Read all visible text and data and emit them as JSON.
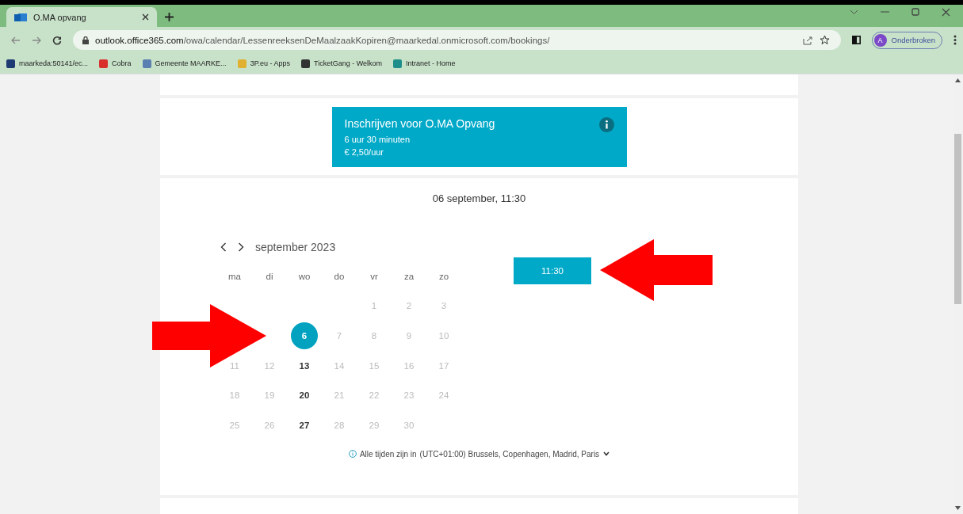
{
  "browser": {
    "tab_title": "O.MA opvang",
    "url_host": "outlook.office365.com",
    "url_path": "/owa/calendar/LessenreeksenDeMaalzaakKopiren@maarkedal.onmicrosoft.com/bookings/",
    "profile": {
      "initial": "A",
      "label": "Onderbroken"
    },
    "bookmarks": [
      {
        "label": "maarkeda:50141/ec..."
      },
      {
        "label": "Cobra"
      },
      {
        "label": "Gemeente MAARKE..."
      },
      {
        "label": "3P.eu - Apps"
      },
      {
        "label": "TicketGang - Welkom"
      },
      {
        "label": "Intranet - Home"
      }
    ]
  },
  "service": {
    "title": "Inschrijven voor O.MA Opvang",
    "duration": "6 uur 30 minuten",
    "price": "€ 2,50/uur"
  },
  "selected_datetime": "06 september, 11:30",
  "calendar": {
    "month": "september 2023",
    "weekdays": [
      "ma",
      "di",
      "wo",
      "do",
      "vr",
      "za",
      "zo"
    ],
    "days": [
      {
        "kind": "blank"
      },
      {
        "kind": "blank"
      },
      {
        "kind": "blank"
      },
      {
        "kind": "blank"
      },
      {
        "kind": "day",
        "day": "1",
        "available": false,
        "selected": false
      },
      {
        "kind": "day",
        "day": "2",
        "available": false,
        "selected": false
      },
      {
        "kind": "day",
        "day": "3",
        "available": false,
        "selected": false
      },
      {
        "kind": "blank"
      },
      {
        "kind": "blank"
      },
      {
        "kind": "day",
        "day": "6",
        "available": true,
        "selected": true
      },
      {
        "kind": "day",
        "day": "7",
        "available": false,
        "selected": false
      },
      {
        "kind": "day",
        "day": "8",
        "available": false,
        "selected": false
      },
      {
        "kind": "day",
        "day": "9",
        "available": false,
        "selected": false
      },
      {
        "kind": "day",
        "day": "10",
        "available": false,
        "selected": false
      },
      {
        "kind": "day",
        "day": "11",
        "available": false,
        "selected": false
      },
      {
        "kind": "day",
        "day": "12",
        "available": false,
        "selected": false
      },
      {
        "kind": "day",
        "day": "13",
        "available": true,
        "selected": false
      },
      {
        "kind": "day",
        "day": "14",
        "available": false,
        "selected": false
      },
      {
        "kind": "day",
        "day": "15",
        "available": false,
        "selected": false
      },
      {
        "kind": "day",
        "day": "16",
        "available": false,
        "selected": false
      },
      {
        "kind": "day",
        "day": "17",
        "available": false,
        "selected": false
      },
      {
        "kind": "day",
        "day": "18",
        "available": false,
        "selected": false
      },
      {
        "kind": "day",
        "day": "19",
        "available": false,
        "selected": false
      },
      {
        "kind": "day",
        "day": "20",
        "available": true,
        "selected": false
      },
      {
        "kind": "day",
        "day": "21",
        "available": false,
        "selected": false
      },
      {
        "kind": "day",
        "day": "22",
        "available": false,
        "selected": false
      },
      {
        "kind": "day",
        "day": "23",
        "available": false,
        "selected": false
      },
      {
        "kind": "day",
        "day": "24",
        "available": false,
        "selected": false
      },
      {
        "kind": "day",
        "day": "25",
        "available": false,
        "selected": false
      },
      {
        "kind": "day",
        "day": "26",
        "available": false,
        "selected": false
      },
      {
        "kind": "day",
        "day": "27",
        "available": true,
        "selected": false
      },
      {
        "kind": "day",
        "day": "28",
        "available": false,
        "selected": false
      },
      {
        "kind": "day",
        "day": "29",
        "available": false,
        "selected": false
      },
      {
        "kind": "day",
        "day": "30",
        "available": false,
        "selected": false
      }
    ]
  },
  "time_slots": [
    {
      "label": "11:30"
    }
  ],
  "timezone": {
    "prefix": "Alle tijden zijn in",
    "value": "(UTC+01:00) Brussels, Copenhagen, Madrid, Paris"
  }
}
